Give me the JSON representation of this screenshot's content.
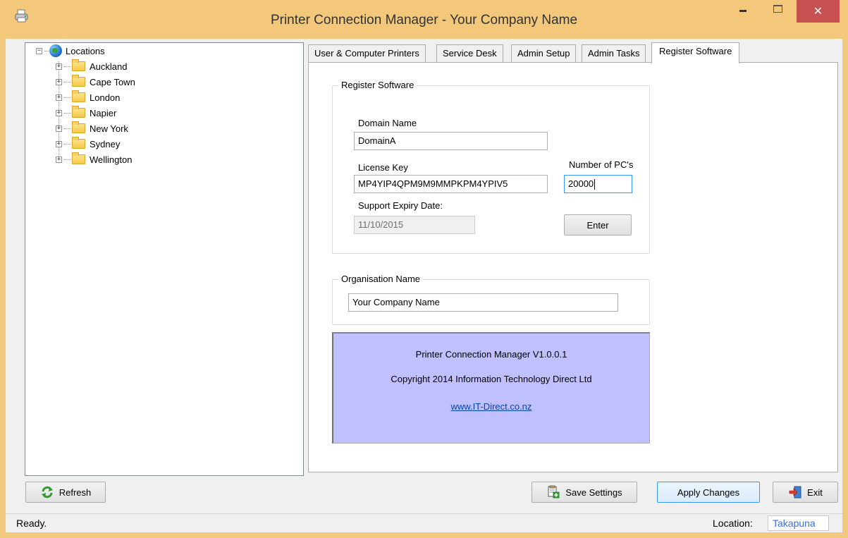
{
  "window": {
    "title": "Printer Connection Manager - Your Company Name",
    "close_glyph": "✕"
  },
  "tree": {
    "root": "Locations",
    "expander_collapsed": "+",
    "expander_expanded": "−",
    "items": [
      "Auckland",
      "Cape Town",
      "London",
      "Napier",
      "New York",
      "Sydney",
      "Wellington"
    ]
  },
  "tabs": [
    "User & Computer Printers",
    "Service Desk",
    "Admin Setup",
    "Admin Tasks",
    "Register Software"
  ],
  "register": {
    "group_title": "Register Software",
    "domain_label": "Domain Name",
    "domain_value": "DomainA",
    "license_label": "License Key",
    "license_value": "MP4YIP4QPM9M9MMPKPM4YPIV5",
    "pcs_label": "Number of PC's",
    "pcs_value": "20000",
    "expiry_label": "Support Expiry Date:",
    "expiry_value": "11/10/2015",
    "enter_label": "Enter"
  },
  "organisation": {
    "group_title": "Organisation Name",
    "value": "Your Company Name"
  },
  "about": {
    "product": "Printer Connection Manager V1.0.0.1",
    "copyright": "Copyright 2014 Information Technology Direct Ltd",
    "link": "www.IT-Direct.co.nz"
  },
  "buttons": {
    "refresh": "Refresh",
    "save": "Save Settings",
    "apply": "Apply Changes",
    "exit": "Exit"
  },
  "status": {
    "text": "Ready.",
    "location_label": "Location:",
    "location_value": "Takapuna"
  },
  "colors": {
    "title_bar": "#f3c87a",
    "close_button": "#c75050",
    "about_panel": "#c0c0ff",
    "location_text": "#3a6fd8"
  }
}
